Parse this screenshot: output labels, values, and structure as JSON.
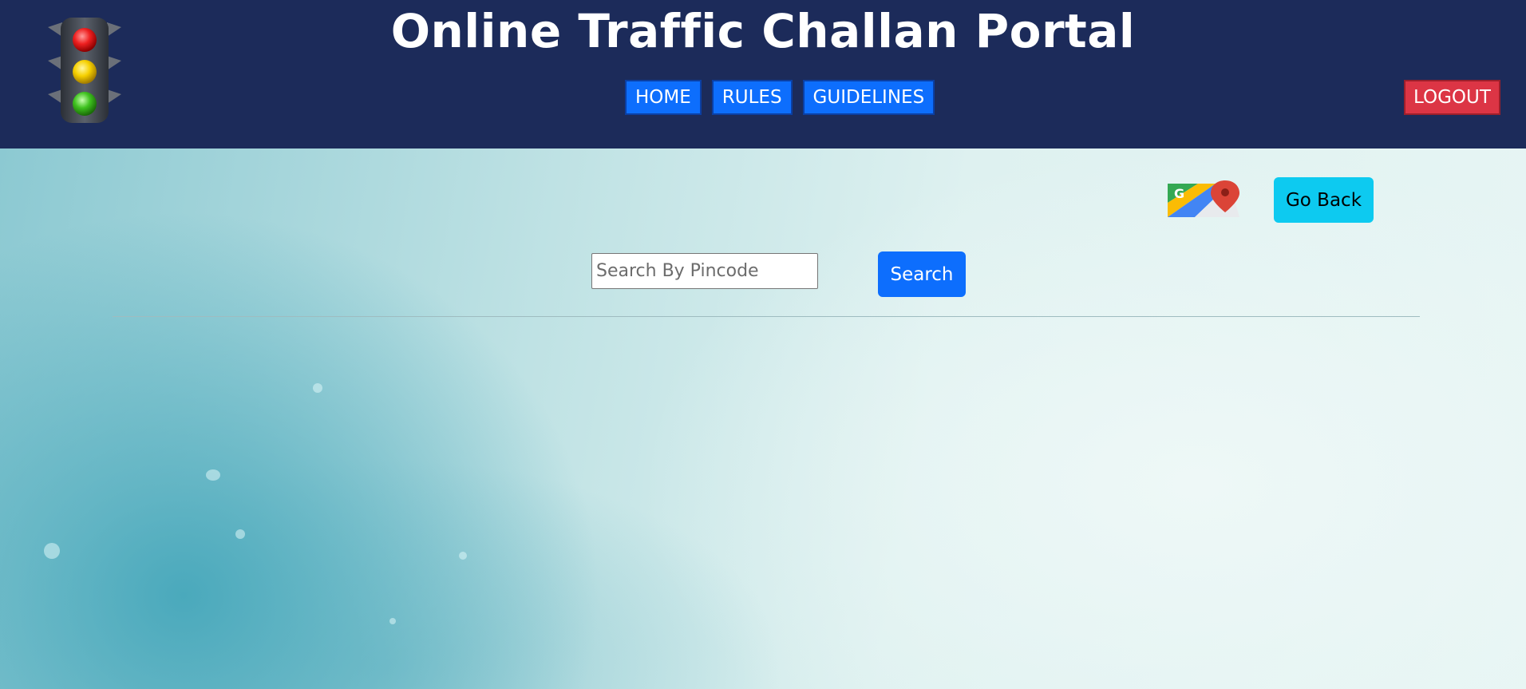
{
  "header": {
    "title": "Online Traffic Challan Portal",
    "logo_icon": "traffic-light-icon",
    "nav": [
      {
        "label": "HOME"
      },
      {
        "label": "RULES"
      },
      {
        "label": "GUIDELINES"
      }
    ],
    "logout_label": "LOGOUT",
    "bg_color": "#1c2b5a"
  },
  "main": {
    "maps_icon": "google-maps-icon",
    "go_back_label": "Go Back",
    "search": {
      "placeholder": "Search By Pincode",
      "value": "",
      "button_label": "Search"
    }
  },
  "colors": {
    "primary": "#0d6efd",
    "danger": "#dc3545",
    "info": "#0dcaf0"
  }
}
